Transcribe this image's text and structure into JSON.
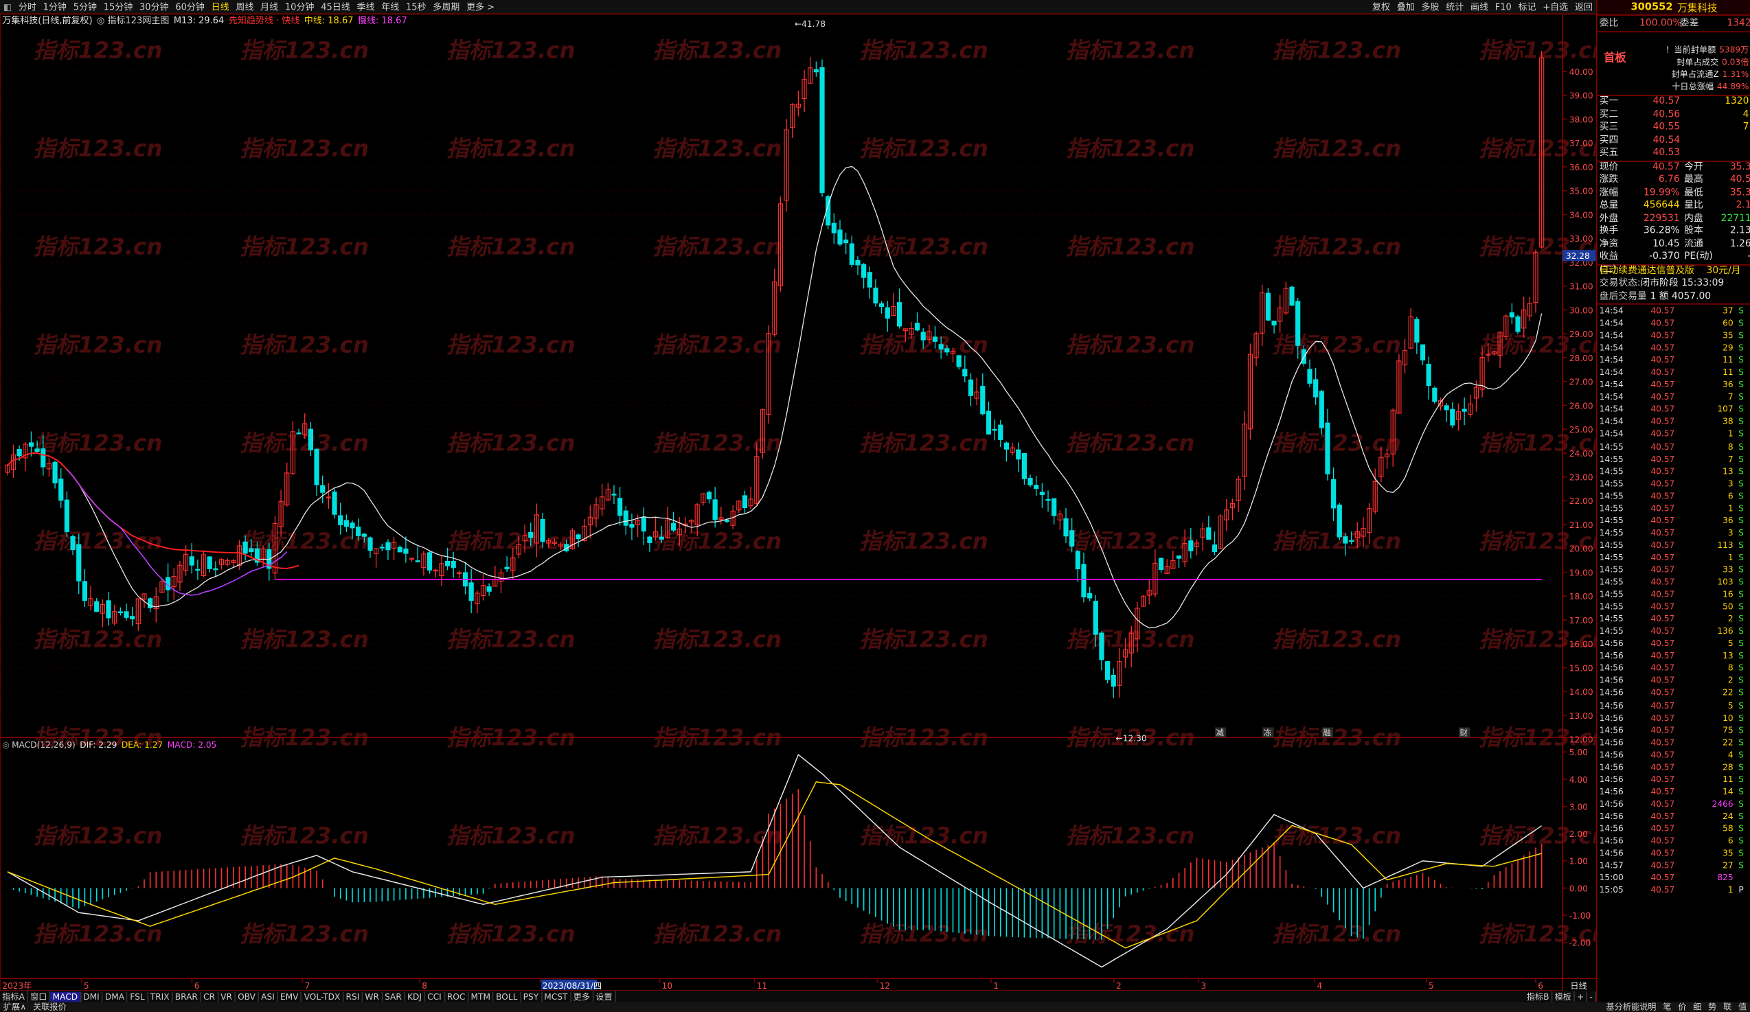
{
  "toolbar": {
    "periods": [
      "分时",
      "1分钟",
      "5分钟",
      "15分钟",
      "30分钟",
      "60分钟",
      "日线",
      "周线",
      "月线",
      "10分钟",
      "45日线",
      "季线",
      "年线",
      "15秒",
      "多周期",
      "更多 >"
    ],
    "active": "日线",
    "right": [
      "复权",
      "叠加",
      "多股",
      "统计",
      "画线",
      "F10",
      "标记",
      "+自选",
      "返回"
    ]
  },
  "stock": {
    "code": "300552",
    "name": "万集科技"
  },
  "main_legend": {
    "title": "万集科技(日线,前复权)",
    "indicator": "◎ 指标123网主图",
    "m13": "M13: 29.64",
    "lead": "先知趋势线 · 快线",
    "mid": "中线: 18.67",
    "slow": "慢线: 18.67"
  },
  "price_axis": {
    "labels": [
      "40.00",
      "39.00",
      "38.00",
      "37.00",
      "36.00",
      "35.00",
      "34.00",
      "33.00",
      "32.00",
      "31.00",
      "30.00",
      "29.00",
      "28.00",
      "27.00",
      "26.00",
      "25.00",
      "24.00",
      "23.00",
      "22.00",
      "21.00",
      "20.00",
      "19.00",
      "18.00",
      "17.00",
      "16.00",
      "15.00",
      "14.00",
      "13.00",
      "12.00"
    ],
    "cursor": "32.28",
    "high": "41.78",
    "low": "12.30"
  },
  "macd_legend": {
    "name": "MACD(12,26,9)",
    "dif": "DIF: 2.29",
    "dea": "DEA: 1.27",
    "macd": "MACD: 2.05"
  },
  "macd_axis": [
    "5.00",
    "4.00",
    "3.00",
    "2.00",
    "1.00",
    "0.00",
    "-1.00",
    "-2.00"
  ],
  "markers": [
    "减",
    "冻",
    "融",
    "财"
  ],
  "x_axis": {
    "labels": [
      "2023年",
      "5",
      "6",
      "7",
      "8",
      "2023/08/31/四",
      "10",
      "11",
      "12",
      "1",
      "2",
      "3",
      "4",
      "5",
      "6"
    ],
    "right": "日线"
  },
  "bottom_tabs": [
    "指标A",
    "窗口",
    "MACD",
    "DMI",
    "DMA",
    "FSL",
    "TRIX",
    "BRAR",
    "CR",
    "VR",
    "OBV",
    "ASI",
    "EMV",
    "VOL-TDX",
    "RSI",
    "WR",
    "SAR",
    "KDJ",
    "CCI",
    "ROC",
    "MTM",
    "BOLL",
    "PSY",
    "MCST",
    "更多",
    "设置"
  ],
  "bottom_active": "MACD",
  "bottom_right": [
    "指标B",
    "模板",
    "+",
    "-"
  ],
  "status_left": "扩展∧",
  "status_left2": "关联报价",
  "status_right": [
    "基分析能说明",
    "笔",
    "价",
    "细",
    "势",
    "联",
    "值"
  ],
  "side_panel": {
    "weibi_label": "委比",
    "weibi_value": "100.00%",
    "weicha_label": "委差",
    "weicha_value": "1342",
    "seal": [
      {
        "label": "！当前封单额",
        "value": "5389万"
      },
      {
        "label": "封单占成交",
        "value": "0.03倍"
      },
      {
        "label": "封单占流通Z",
        "value": "1.31%"
      },
      {
        "label": "十日总涨幅",
        "value": "44.89%"
      }
    ],
    "board_tag": "首板",
    "bids": [
      {
        "label": "买一",
        "price": "40.57",
        "vol": "1320"
      },
      {
        "label": "买二",
        "price": "40.56",
        "vol": "4"
      },
      {
        "label": "买三",
        "price": "40.55",
        "vol": "7"
      },
      {
        "label": "买四",
        "price": "40.54",
        "vol": ""
      },
      {
        "label": "买五",
        "price": "40.53",
        "vol": ""
      }
    ],
    "quote": [
      {
        "l1": "现价",
        "v1": "40.57",
        "l2": "今开",
        "v2": "35.3"
      },
      {
        "l1": "涨跌",
        "v1": "6.76",
        "l2": "最高",
        "v2": "40.5"
      },
      {
        "l1": "涨幅",
        "v1": "19.99%",
        "l2": "最低",
        "v2": "35.3"
      },
      {
        "l1": "总量",
        "v1": "456644",
        "l2": "量比",
        "v2": "2.1"
      },
      {
        "l1": "外盘",
        "v1": "229531",
        "l2": "内盘",
        "v2": "22711"
      },
      {
        "l1": "换手",
        "v1": "36.28%",
        "l2": "股本",
        "v2": "2.13"
      },
      {
        "l1": "净资",
        "v1": "10.45",
        "l2": "流通",
        "v2": "1.26"
      },
      {
        "l1": "收益(二)",
        "v1": "-0.370",
        "l2": "PE(动)",
        "v2": "-"
      }
    ],
    "ad": "自动续费通达信普及版",
    "ad_price": "30元/月",
    "trade_state_label": "交易状态:",
    "trade_state": "闭市阶段 15:33:09",
    "after_label": "盘后交易量",
    "after_value": "1 额 4057.00",
    "ticks": [
      [
        "14:54",
        "40.57",
        "37",
        "S"
      ],
      [
        "14:54",
        "40.57",
        "60",
        "S"
      ],
      [
        "14:54",
        "40.57",
        "35",
        "S"
      ],
      [
        "14:54",
        "40.57",
        "29",
        "S"
      ],
      [
        "14:54",
        "40.57",
        "11",
        "S"
      ],
      [
        "14:54",
        "40.57",
        "11",
        "S"
      ],
      [
        "14:54",
        "40.57",
        "36",
        "S"
      ],
      [
        "14:54",
        "40.57",
        "7",
        "S"
      ],
      [
        "14:54",
        "40.57",
        "107",
        "S"
      ],
      [
        "14:54",
        "40.57",
        "38",
        "S"
      ],
      [
        "14:54",
        "40.57",
        "1",
        "S"
      ],
      [
        "14:55",
        "40.57",
        "8",
        "S"
      ],
      [
        "14:55",
        "40.57",
        "7",
        "S"
      ],
      [
        "14:55",
        "40.57",
        "13",
        "S"
      ],
      [
        "14:55",
        "40.57",
        "3",
        "S"
      ],
      [
        "14:55",
        "40.57",
        "6",
        "S"
      ],
      [
        "14:55",
        "40.57",
        "1",
        "S"
      ],
      [
        "14:55",
        "40.57",
        "36",
        "S"
      ],
      [
        "14:55",
        "40.57",
        "3",
        "S"
      ],
      [
        "14:55",
        "40.57",
        "113",
        "S"
      ],
      [
        "14:55",
        "40.57",
        "1",
        "S"
      ],
      [
        "14:55",
        "40.57",
        "33",
        "S"
      ],
      [
        "14:55",
        "40.57",
        "103",
        "S"
      ],
      [
        "14:55",
        "40.57",
        "16",
        "S"
      ],
      [
        "14:55",
        "40.57",
        "50",
        "S"
      ],
      [
        "14:55",
        "40.57",
        "2",
        "S"
      ],
      [
        "14:55",
        "40.57",
        "136",
        "S"
      ],
      [
        "14:56",
        "40.57",
        "5",
        "S"
      ],
      [
        "14:56",
        "40.57",
        "13",
        "S"
      ],
      [
        "14:56",
        "40.57",
        "8",
        "S"
      ],
      [
        "14:56",
        "40.57",
        "2",
        "S"
      ],
      [
        "14:56",
        "40.57",
        "22",
        "S"
      ],
      [
        "14:56",
        "40.57",
        "5",
        "S"
      ],
      [
        "14:56",
        "40.57",
        "10",
        "S"
      ],
      [
        "14:56",
        "40.57",
        "75",
        "S"
      ],
      [
        "14:56",
        "40.57",
        "22",
        "S"
      ],
      [
        "14:56",
        "40.57",
        "4",
        "S"
      ],
      [
        "14:56",
        "40.57",
        "28",
        "S"
      ],
      [
        "14:56",
        "40.57",
        "11",
        "S"
      ],
      [
        "14:56",
        "40.57",
        "14",
        "S"
      ],
      [
        "14:56",
        "40.57",
        "2466",
        "S"
      ],
      [
        "14:56",
        "40.57",
        "24",
        "S"
      ],
      [
        "14:56",
        "40.57",
        "58",
        "S"
      ],
      [
        "14:56",
        "40.57",
        "6",
        "S"
      ],
      [
        "14:56",
        "40.57",
        "35",
        "S"
      ],
      [
        "14:57",
        "40.57",
        "27",
        "S"
      ],
      [
        "15:00",
        "40.57",
        "825",
        ""
      ],
      [
        "15:05",
        "40.57",
        "1",
        "P"
      ]
    ]
  },
  "watermark": "指标123.cn",
  "colors": {
    "up": "#ff3030",
    "down": "#00e0e0",
    "dif": "#e8e8e8",
    "dea": "#ffd700",
    "lead": "#ff2020",
    "mid": "#b040ff",
    "pink": "#ff00ff",
    "frame": "#800000"
  },
  "chart_data": [
    {
      "type": "candlestick",
      "title": "万集科技(日线,前复权)",
      "yrange": [
        12,
        41.78
      ],
      "high": 41.78,
      "low": 12.3,
      "support_line": 18.7,
      "x_labels": [
        "2023年",
        "5",
        "6",
        "7",
        "8",
        "2023/08/31/四",
        "10",
        "11",
        "12",
        "1",
        "2",
        "3",
        "4",
        "5",
        "6"
      ],
      "waypoints": [
        [
          0,
          23.5
        ],
        [
          3,
          24.6
        ],
        [
          6,
          23.8
        ],
        [
          9,
          22.1
        ],
        [
          12,
          18.5
        ],
        [
          15,
          17.6
        ],
        [
          18,
          17.3
        ],
        [
          22,
          17.5
        ],
        [
          26,
          18.2
        ],
        [
          30,
          19.6
        ],
        [
          34,
          19.2
        ],
        [
          38,
          19.8
        ],
        [
          41,
          20.0
        ],
        [
          44,
          19.4
        ],
        [
          46,
          22.0
        ],
        [
          48,
          24.8
        ],
        [
          50,
          25.0
        ],
        [
          52,
          23.0
        ],
        [
          54,
          22.2
        ],
        [
          57,
          21.0
        ],
        [
          60,
          20.1
        ],
        [
          64,
          20.0
        ],
        [
          68,
          19.8
        ],
        [
          72,
          19.3
        ],
        [
          76,
          18.6
        ],
        [
          78,
          17.6
        ],
        [
          80,
          18.4
        ],
        [
          83,
          19.1
        ],
        [
          86,
          20.0
        ],
        [
          89,
          21.0
        ],
        [
          92,
          20.2
        ],
        [
          95,
          20.3
        ],
        [
          97,
          20.6
        ],
        [
          100,
          22.5
        ],
        [
          103,
          21.6
        ],
        [
          106,
          21.0
        ],
        [
          108,
          20.1
        ],
        [
          111,
          20.9
        ],
        [
          114,
          21.4
        ],
        [
          117,
          22.0
        ],
        [
          120,
          21.3
        ],
        [
          123,
          22.0
        ],
        [
          125,
          22.2
        ],
        [
          127,
          26.0
        ],
        [
          129,
          31.5
        ],
        [
          131,
          38.0
        ],
        [
          133,
          39.0
        ],
        [
          135,
          40.5
        ],
        [
          136,
          40.0
        ],
        [
          137,
          35.0
        ],
        [
          139,
          33.0
        ],
        [
          141,
          32.6
        ],
        [
          143,
          31.5
        ],
        [
          146,
          30.5
        ],
        [
          149,
          29.8
        ],
        [
          152,
          29.5
        ],
        [
          155,
          29.0
        ],
        [
          158,
          28.2
        ],
        [
          161,
          27.3
        ],
        [
          163,
          26.2
        ],
        [
          165,
          24.8
        ],
        [
          168,
          24.2
        ],
        [
          171,
          23.0
        ],
        [
          174,
          22.0
        ],
        [
          177,
          21.0
        ],
        [
          180,
          19.2
        ],
        [
          182,
          17.5
        ],
        [
          184,
          15.2
        ],
        [
          186,
          14.0
        ],
        [
          187,
          15.0
        ],
        [
          189,
          16.5
        ],
        [
          191,
          17.8
        ],
        [
          193,
          19.5
        ],
        [
          195,
          18.8
        ],
        [
          197,
          19.9
        ],
        [
          199,
          20.2
        ],
        [
          201,
          20.8
        ],
        [
          203,
          20.3
        ],
        [
          205,
          21.6
        ],
        [
          207,
          23.0
        ],
        [
          209,
          28.0
        ],
        [
          211,
          30.5
        ],
        [
          213,
          29.0
        ],
        [
          215,
          31.0
        ],
        [
          217,
          28.8
        ],
        [
          219,
          27.0
        ],
        [
          221,
          25.0
        ],
        [
          223,
          22.0
        ],
        [
          224,
          20.5
        ],
        [
          226,
          20.4
        ],
        [
          228,
          21.0
        ],
        [
          230,
          23.2
        ],
        [
          232,
          24.0
        ],
        [
          234,
          27.5
        ],
        [
          236,
          29.8
        ],
        [
          238,
          28.0
        ],
        [
          240,
          26.5
        ],
        [
          242,
          25.5
        ],
        [
          244,
          25.7
        ],
        [
          246,
          26.2
        ],
        [
          248,
          27.8
        ],
        [
          250,
          28.5
        ],
        [
          252,
          29.4
        ],
        [
          254,
          29.2
        ],
        [
          256,
          30.0
        ],
        [
          257,
          32.5
        ],
        [
          258,
          40.57
        ]
      ],
      "macd_dif_waypoints": [
        [
          0,
          0.6
        ],
        [
          12,
          -0.9
        ],
        [
          22,
          -1.2
        ],
        [
          46,
          0.8
        ],
        [
          52,
          1.2
        ],
        [
          58,
          0.6
        ],
        [
          80,
          -0.6
        ],
        [
          100,
          0.4
        ],
        [
          125,
          0.6
        ],
        [
          133,
          4.9
        ],
        [
          137,
          4.2
        ],
        [
          150,
          1.5
        ],
        [
          165,
          -0.5
        ],
        [
          184,
          -2.9
        ],
        [
          195,
          -1.5
        ],
        [
          205,
          0.5
        ],
        [
          213,
          2.7
        ],
        [
          220,
          2.0
        ],
        [
          228,
          0.0
        ],
        [
          238,
          1.0
        ],
        [
          248,
          0.8
        ],
        [
          258,
          2.29
        ]
      ],
      "macd_dea_waypoints": [
        [
          0,
          0.6
        ],
        [
          14,
          -0.6
        ],
        [
          24,
          -1.4
        ],
        [
          48,
          0.4
        ],
        [
          55,
          1.1
        ],
        [
          62,
          0.7
        ],
        [
          82,
          -0.6
        ],
        [
          102,
          0.2
        ],
        [
          128,
          0.5
        ],
        [
          136,
          3.9
        ],
        [
          140,
          3.8
        ],
        [
          155,
          1.8
        ],
        [
          170,
          0.0
        ],
        [
          188,
          -2.2
        ],
        [
          200,
          -1.2
        ],
        [
          210,
          1.0
        ],
        [
          216,
          2.3
        ],
        [
          226,
          1.6
        ],
        [
          232,
          0.3
        ],
        [
          242,
          0.9
        ],
        [
          250,
          0.8
        ],
        [
          258,
          1.27
        ]
      ]
    }
  ]
}
